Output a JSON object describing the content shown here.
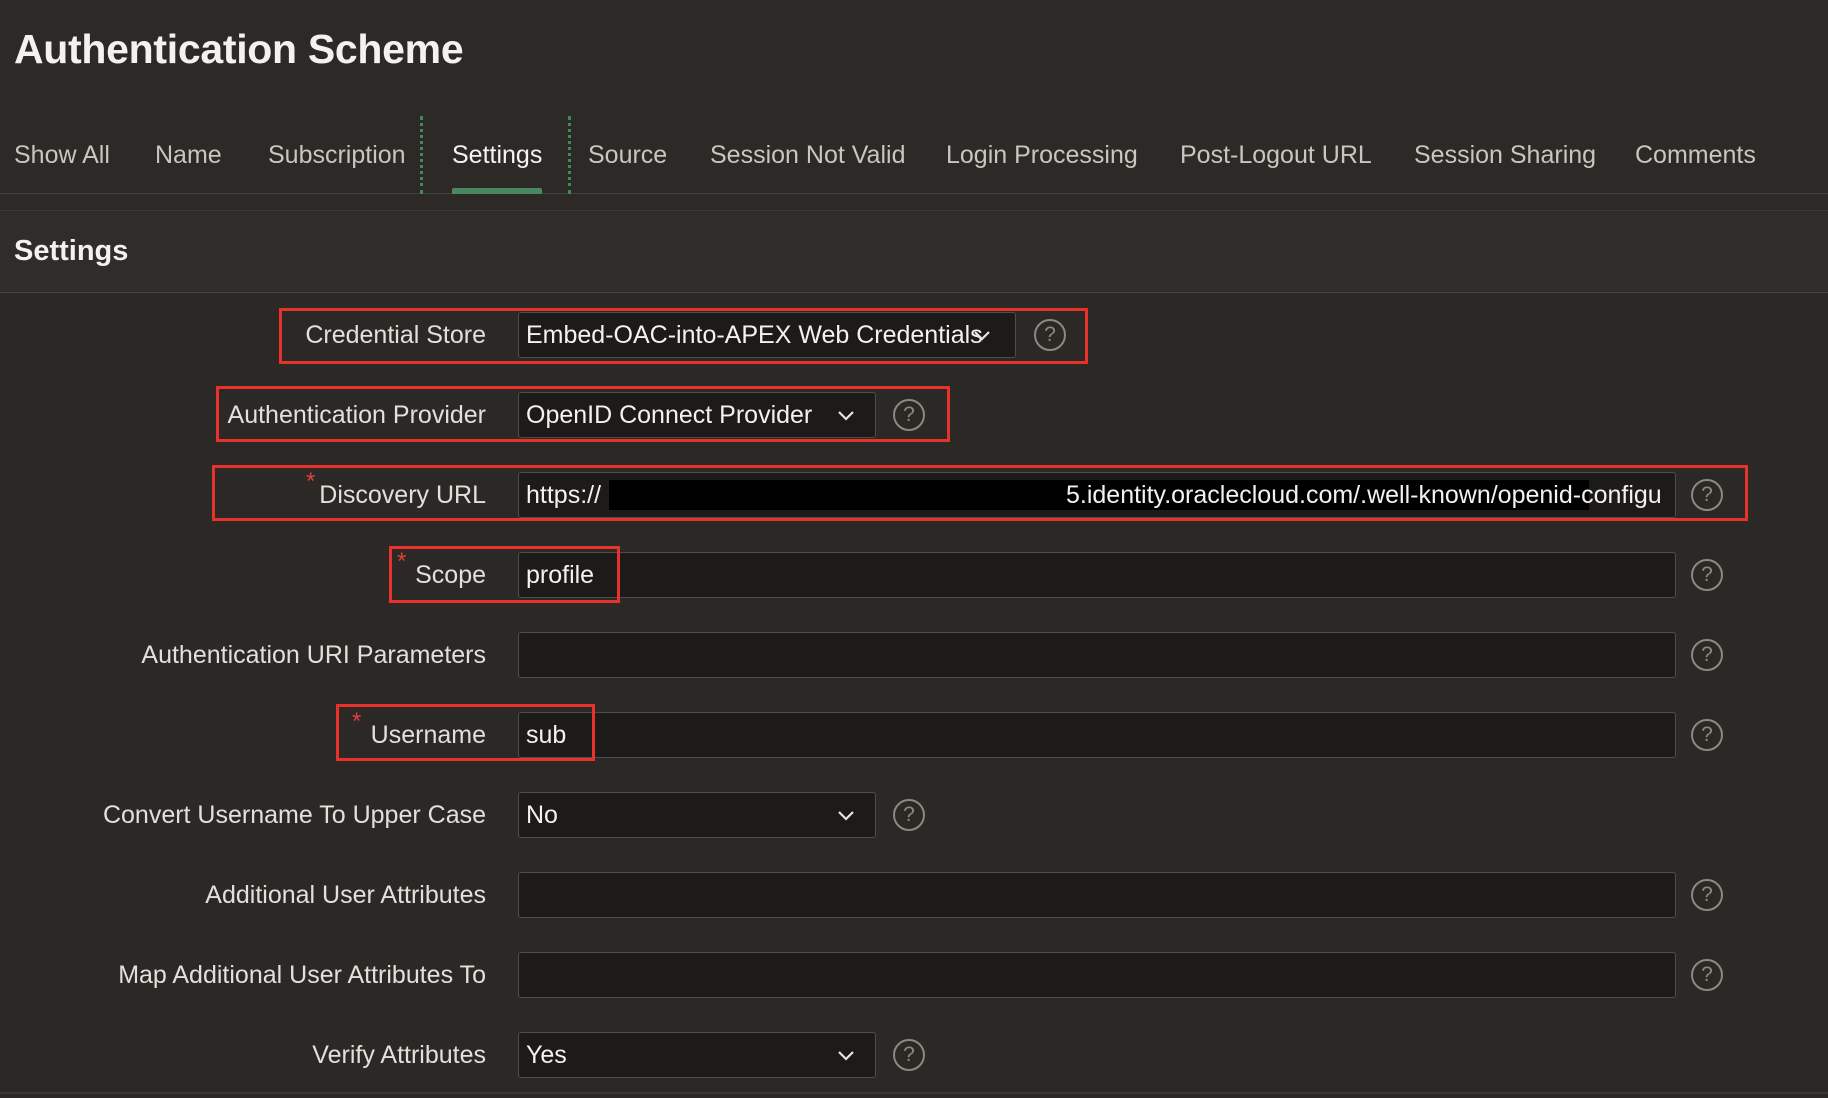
{
  "page": {
    "title": "Authentication Scheme"
  },
  "tabs": [
    {
      "label": "Show All"
    },
    {
      "label": "Name"
    },
    {
      "label": "Subscription"
    },
    {
      "label": "Settings",
      "active": true
    },
    {
      "label": "Source"
    },
    {
      "label": "Session Not Valid"
    },
    {
      "label": "Login Processing"
    },
    {
      "label": "Post-Logout URL"
    },
    {
      "label": "Session Sharing"
    },
    {
      "label": "Comments"
    }
  ],
  "settings": {
    "title": "Settings",
    "credential_store": {
      "label": "Credential Store",
      "value": "Embed-OAC-into-APEX Web Credentials"
    },
    "authentication_provider": {
      "label": "Authentication Provider",
      "value": "OpenID Connect Provider"
    },
    "discovery_url": {
      "label": "Discovery URL",
      "value_prefix": "https://",
      "value_suffix": "5.identity.oraclecloud.com/.well-known/openid-configu",
      "required": true
    },
    "scope": {
      "label": "Scope",
      "value": "profile",
      "required": true
    },
    "auth_uri_params": {
      "label": "Authentication URI Parameters",
      "value": ""
    },
    "username": {
      "label": "Username",
      "value": "sub",
      "required": true
    },
    "convert_upper": {
      "label": "Convert Username To Upper Case",
      "value": "No"
    },
    "additional_attrs": {
      "label": "Additional User Attributes",
      "value": ""
    },
    "map_attrs": {
      "label": "Map Additional User Attributes To",
      "value": ""
    },
    "verify_attrs": {
      "label": "Verify Attributes",
      "value": "Yes"
    }
  },
  "icons": {
    "help": "?",
    "required_marker": "*"
  },
  "colors": {
    "background": "#2c2926",
    "active_tab_underline": "#48875f",
    "highlight_box": "#e6322b",
    "required_marker": "#e0413a"
  }
}
